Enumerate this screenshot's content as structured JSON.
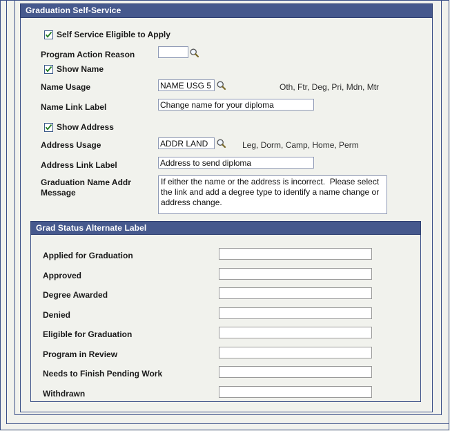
{
  "window": {
    "background_color": "#f1f2ed",
    "frame_color": "#3a4f87"
  },
  "main_group": {
    "title": "Graduation Self-Service",
    "header_bg": "#46598d",
    "header_fg": "#ffffff",
    "checkboxes": [
      {
        "label": "Self Service Eligible to Apply",
        "checked": true,
        "check_color": "#1f7a1f"
      },
      {
        "label": "Show Name",
        "checked": true,
        "check_color": "#1f7a1f"
      },
      {
        "label": "Show Address",
        "checked": true,
        "check_color": "#1f7a1f"
      }
    ],
    "fields": [
      {
        "label": "Program Action Reason",
        "value": "",
        "has_lookup": true,
        "lookup_icon": "magnifier-icon",
        "hint": ""
      },
      {
        "label": "Name Usage",
        "value": "NAME USG 5",
        "has_lookup": true,
        "lookup_icon": "magnifier-icon",
        "hint": "Oth, Ftr, Deg, Pri, Mdn, Mtr"
      },
      {
        "label": "Name Link Label",
        "value": "Change name for your diploma",
        "has_lookup": false,
        "hint": ""
      },
      {
        "label": "Address Usage",
        "value": "ADDR LAND",
        "has_lookup": true,
        "lookup_icon": "magnifier-icon",
        "hint": "Leg, Dorm, Camp, Home, Perm"
      },
      {
        "label": "Address Link Label",
        "value": "Address to send diploma",
        "has_lookup": false,
        "hint": ""
      }
    ],
    "message_field": {
      "label_line1": "Graduation Name Addr",
      "label_line2": "Message",
      "value": "If either the name or the address is incorrect.  Please select the link and add a degree type to identify a name change or address change."
    }
  },
  "sub_group": {
    "title": "Grad Status Alternate Label",
    "rows": [
      {
        "label": "Applied for Graduation",
        "value": ""
      },
      {
        "label": "Approved",
        "value": ""
      },
      {
        "label": "Degree Awarded",
        "value": ""
      },
      {
        "label": "Denied",
        "value": ""
      },
      {
        "label": "Eligible for Graduation",
        "value": ""
      },
      {
        "label": "Program in Review",
        "value": ""
      },
      {
        "label": "Needs to Finish Pending Work",
        "value": ""
      },
      {
        "label": "Withdrawn",
        "value": ""
      }
    ]
  }
}
